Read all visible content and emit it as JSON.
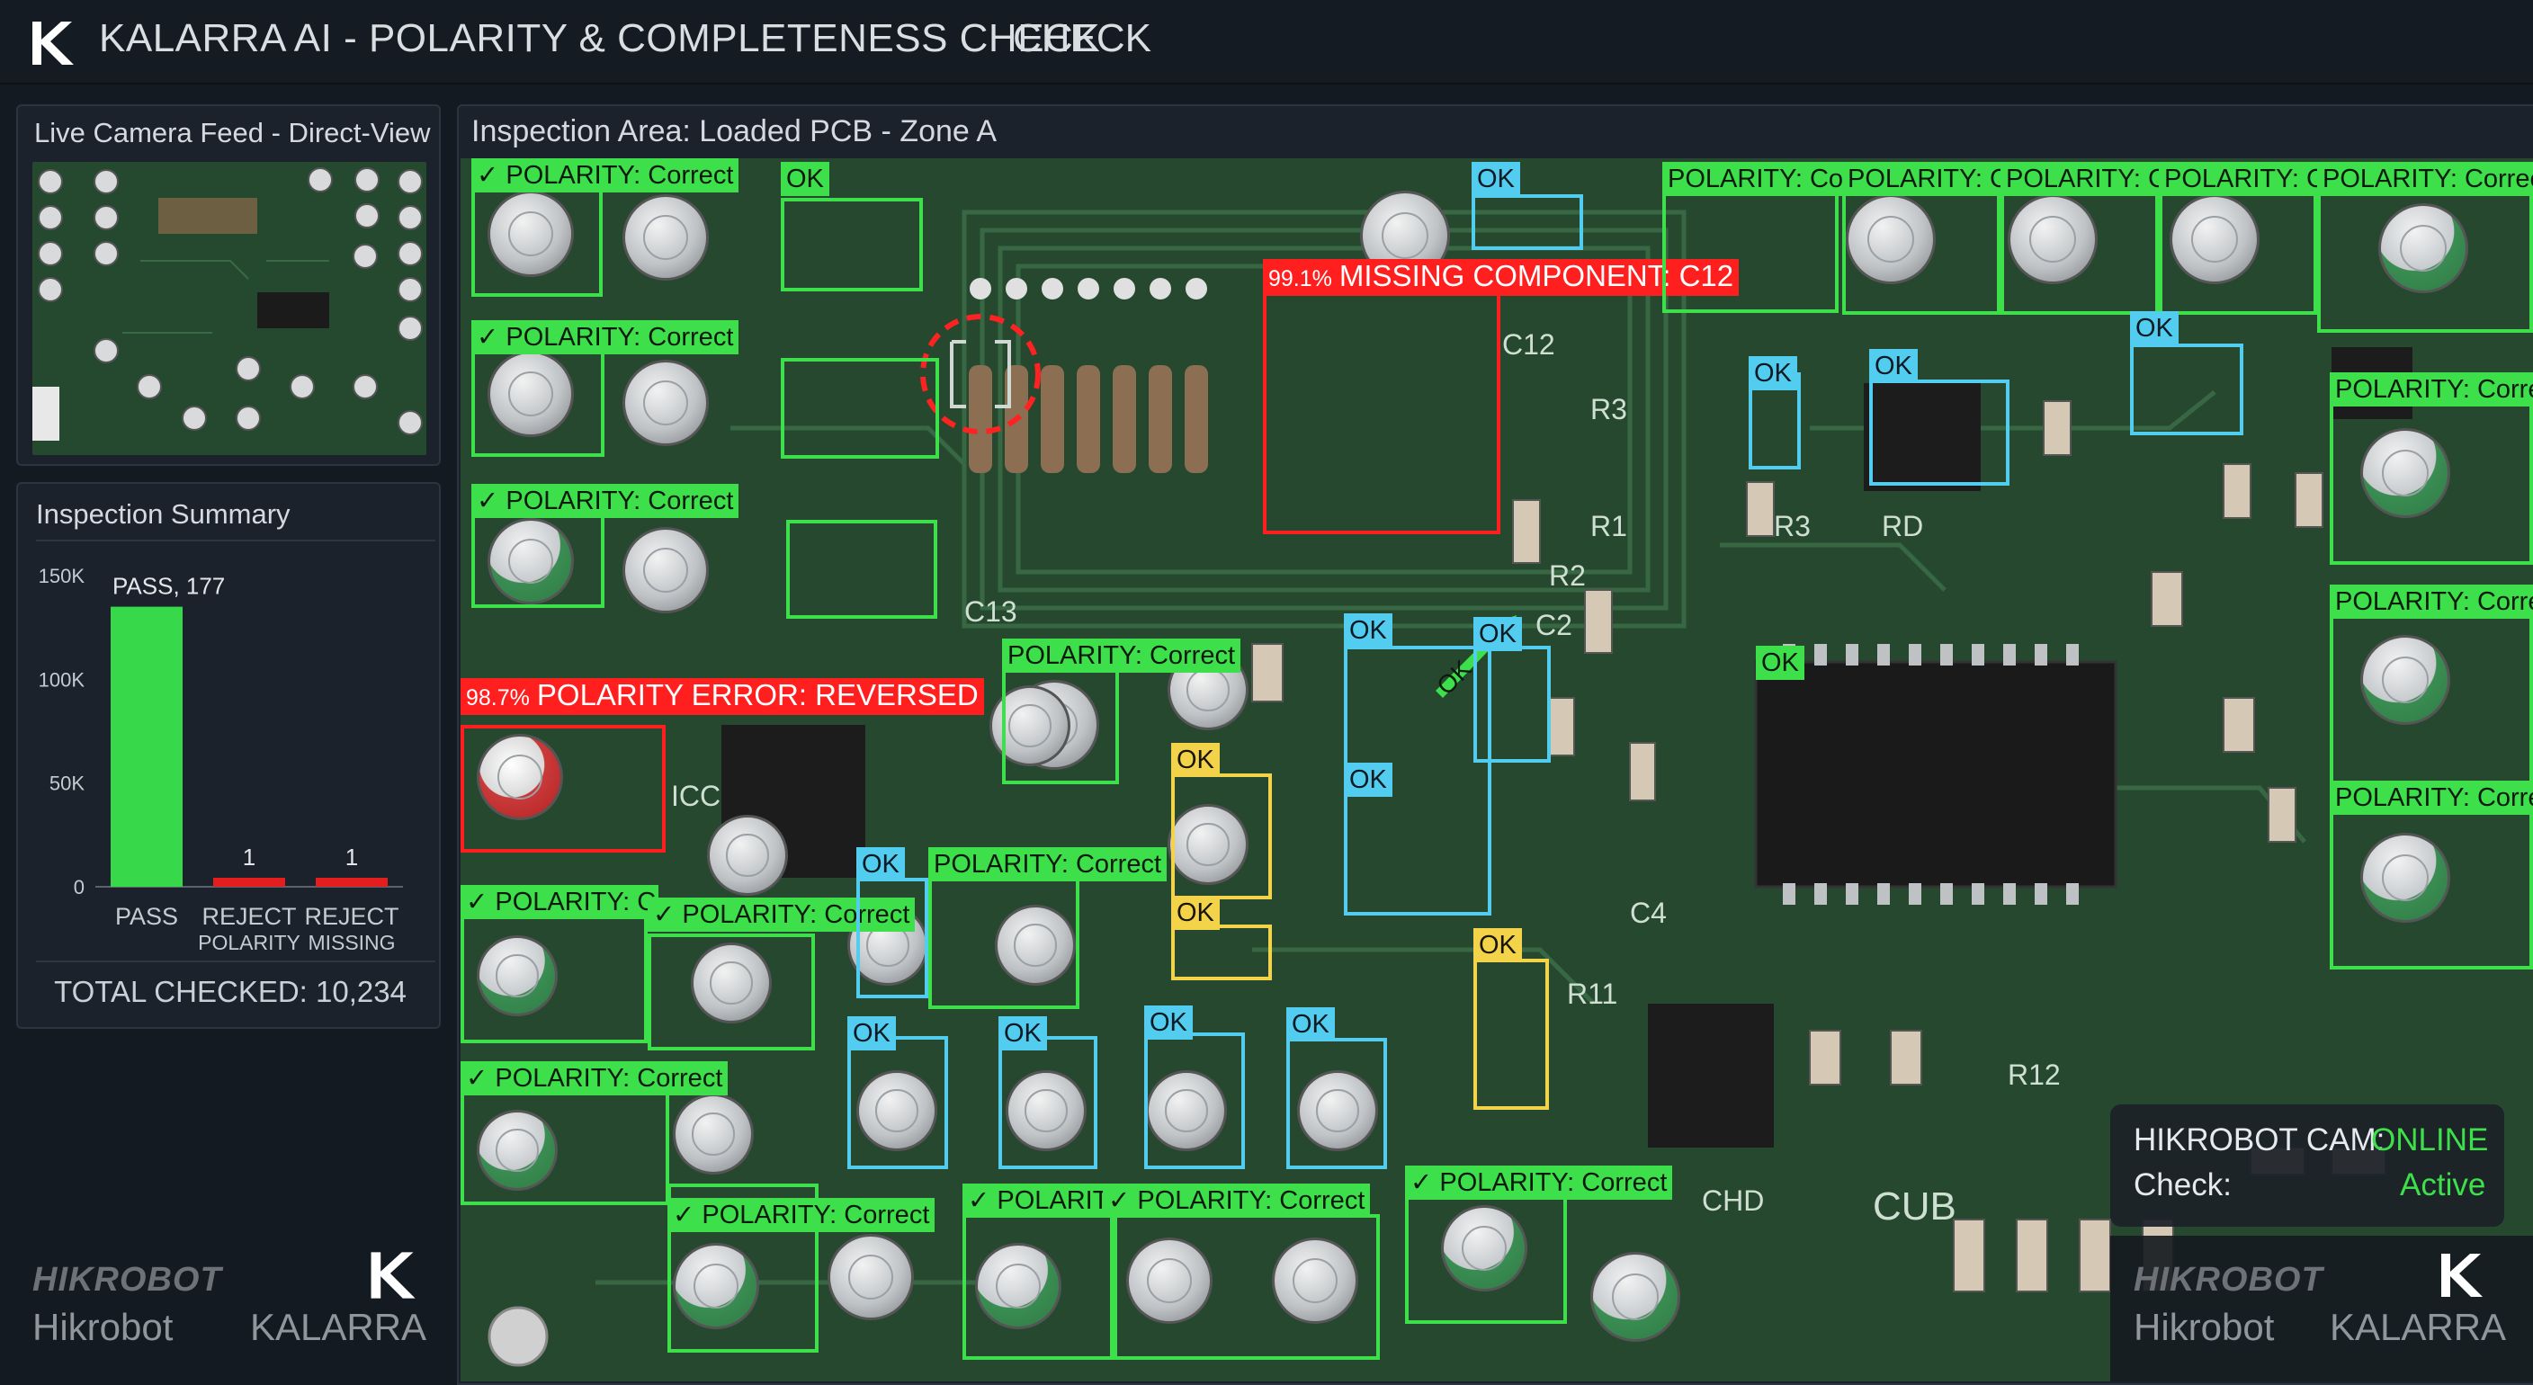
{
  "header": {
    "title": "KALARRA AI - POLARITY & COMPLETENESS CHECK",
    "mode_tab": "CHECK"
  },
  "camera_panel": {
    "title": "Live Camera Feed - Direct-View"
  },
  "summary_panel": {
    "title": "Inspection Summary",
    "total": "TOTAL CHECKED: 10,234",
    "colors": {
      "pass": "#37d84a",
      "reject": "#e41e1e"
    }
  },
  "chart_data": {
    "type": "bar",
    "categories": [
      "PASS",
      "REJECT POLARITY",
      "REJECT MISSING"
    ],
    "category_lines": [
      [
        "PASS"
      ],
      [
        "REJECT",
        "POLARITY"
      ],
      [
        "REJECT",
        "MISSING"
      ]
    ],
    "values": [
      135000,
      1,
      1
    ],
    "data_labels": [
      "PASS, 177",
      "1",
      "1"
    ],
    "ylim": [
      0,
      150000
    ],
    "yticks": [
      0,
      50000,
      100000,
      150000
    ],
    "ytick_labels": [
      "0",
      "50K",
      "100K",
      "150K"
    ],
    "grid": false
  },
  "inspection": {
    "title": "Inspection Area: Loaded PCB - Zone A",
    "silkscreen": [
      "C12",
      "C13",
      "R3",
      "R1",
      "R2",
      "C2",
      "ICC",
      "C4",
      "R11",
      "R12",
      "R3",
      "RD",
      "CUB",
      "CHD"
    ],
    "detections": [
      {
        "label": "✓ POLARITY: Correct",
        "status": "green"
      },
      {
        "label": "OK",
        "status": "green"
      },
      {
        "label": "✓ POLARITY: Correct",
        "status": "green"
      },
      {
        "label": "✓ POLARITY: Correct",
        "status": "green"
      },
      {
        "label": "OK",
        "status": "cyan"
      },
      {
        "label": "MISSING COMPONENT: C12",
        "confidence": "99.1%",
        "status": "red"
      },
      {
        "label": "POLARITY: Cor",
        "status": "green"
      },
      {
        "label": "POLARITY: C",
        "status": "green"
      },
      {
        "label": "POLARITY: C",
        "status": "green"
      },
      {
        "label": "POLARITY: C",
        "status": "green"
      },
      {
        "label": "POLARITY: Correct",
        "status": "green"
      },
      {
        "label": "OK",
        "status": "cyan"
      },
      {
        "label": "OK",
        "status": "cyan"
      },
      {
        "label": "OK",
        "status": "cyan"
      },
      {
        "label": "POLARITY: Corre",
        "status": "green"
      },
      {
        "label": "POLARITY: Corre",
        "status": "green"
      },
      {
        "label": "POLARITY: Corre",
        "status": "green"
      },
      {
        "label": "POLARITY ERROR: REVERSED",
        "confidence": "98.7%",
        "status": "red"
      },
      {
        "label": "POLARITY: Correct",
        "status": "green"
      },
      {
        "label": "OK",
        "status": "cyan"
      },
      {
        "label": "OK",
        "status": "cyan"
      },
      {
        "label": "OK",
        "status": "yellow"
      },
      {
        "label": "OK",
        "status": "cyan"
      },
      {
        "label": "OK",
        "status": "green"
      },
      {
        "label": "✓ POLARITY: C",
        "status": "green"
      },
      {
        "label": "✓ POLARITY: Correct",
        "status": "green"
      },
      {
        "label": "OK",
        "status": "cyan"
      },
      {
        "label": "POLARITY: Correct",
        "status": "green"
      },
      {
        "label": "OK",
        "status": "yellow"
      },
      {
        "label": "OK",
        "status": "yellow"
      },
      {
        "label": "✓ POLARITY: Correct",
        "status": "green"
      },
      {
        "label": "OK",
        "status": "cyan"
      },
      {
        "label": "OK",
        "status": "cyan"
      },
      {
        "label": "OK",
        "status": "cyan"
      },
      {
        "label": "OK",
        "status": "cyan"
      },
      {
        "label": "✓ POLARITY: Correct",
        "status": "green"
      },
      {
        "label": "✓ POLARIT",
        "status": "green"
      },
      {
        "label": "✓ POLARITY: Correct",
        "status": "green"
      },
      {
        "label": "✓ POLARITY: Correct",
        "status": "green"
      }
    ],
    "ic_tag": "OK"
  },
  "hud": {
    "cam_label": "HIKROBOT CAM:",
    "cam_status": "ONLINE",
    "check_label": "Check:",
    "check_status": "Active",
    "colors": {
      "online": "#3de04a"
    }
  },
  "branding": {
    "hikrobot_logo": "HIKROBOT",
    "hikrobot": "Hikrobot",
    "kalarra": "KALARRA"
  },
  "icons": [
    "kalarra-k-logo",
    "polarity-arrow-icon",
    "target-ring-icon"
  ]
}
